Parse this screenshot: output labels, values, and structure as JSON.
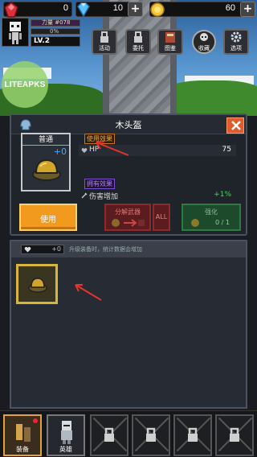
{
  "watermark": "LITEAPKS",
  "resources": {
    "gems": "0",
    "diamonds": "10",
    "gold": "60",
    "gem_color": "#d8323c",
    "diamond_color": "#5cc3ff",
    "gold_color": "#f2c436"
  },
  "player": {
    "power_label": "力量 #078",
    "exp_percent": "0%",
    "level": "LV.2"
  },
  "top_menu": [
    {
      "label": "活动",
      "icon": "lock-icon"
    },
    {
      "label": "委托",
      "icon": "lock-icon"
    },
    {
      "label": "图鉴",
      "icon": "book-icon"
    },
    {
      "label": "收藏",
      "icon": "skull-icon"
    },
    {
      "label": "选项",
      "icon": "gear-icon"
    }
  ],
  "item_panel": {
    "title": "木头盔",
    "rarity": "普通",
    "enhance_level": "+0",
    "use_effect_tag": "使用效果",
    "use_stat_name": "HP",
    "use_stat_value": "75",
    "own_effect_tag": "拥有效果",
    "own_stat_name": "伤害增加",
    "own_stat_value": "+1%",
    "equip_label": "使用",
    "dismantle_label": "分解武器",
    "all_label": "ALL",
    "enhance_label": "强化",
    "enhance_count": "0 / 1"
  },
  "inventory": {
    "counter": "+0",
    "hint": "升级装备时，统计数据会增加"
  },
  "bottom_tabs": [
    {
      "label": "装备",
      "active": true
    },
    {
      "label": "英雄",
      "active": false
    },
    {
      "label": "",
      "locked": true
    },
    {
      "label": "",
      "locked": true
    },
    {
      "label": "",
      "locked": true
    },
    {
      "label": "",
      "locked": true
    }
  ]
}
